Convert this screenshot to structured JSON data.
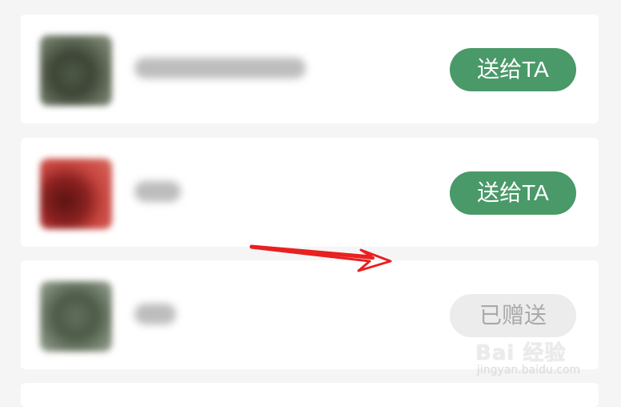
{
  "rows": [
    {
      "action_label": "送给TA"
    },
    {
      "action_label": "送给TA"
    },
    {
      "action_label": "已赠送"
    }
  ],
  "watermark": {
    "brand": "Bai 经验",
    "url": "jingyan.baidu.com"
  },
  "colors": {
    "send_button": "#4a9968",
    "sent_button": "#ececec",
    "annotation_arrow": "#e82020"
  }
}
